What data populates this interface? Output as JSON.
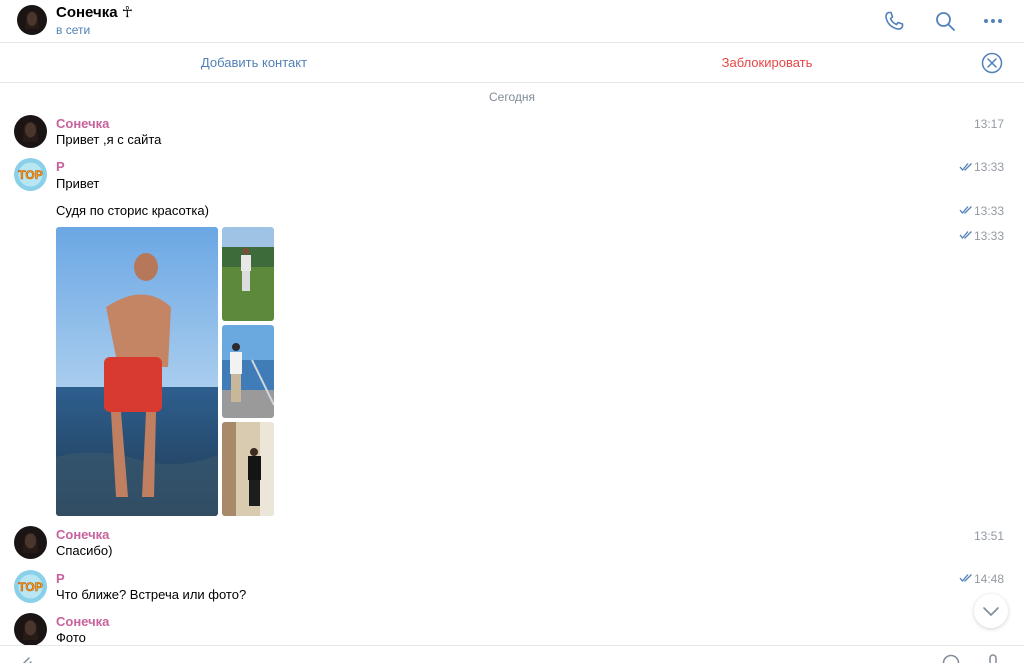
{
  "header": {
    "title": "Сонечка ☥",
    "status": "в сети",
    "icons": [
      "phone-icon",
      "search-icon",
      "more-icon"
    ]
  },
  "actions": {
    "add_contact": "Добавить контакт",
    "block": "Заблокировать"
  },
  "date_separator": "Сегодня",
  "messages": [
    {
      "sender": "Сонечка",
      "text": "Привет ,я с сайта",
      "time": "13:17"
    },
    {
      "sender": "Р",
      "text": "Привет",
      "time": "13:33",
      "read": true
    },
    {
      "text": "Судя по сторис красотка)",
      "time": "13:33",
      "read": true
    },
    {
      "photos": 4,
      "time": "13:33",
      "read": true
    },
    {
      "sender": "Сонечка",
      "text": "Спасибо)",
      "time": "13:51"
    },
    {
      "sender": "Р",
      "text": "Что ближе? Встреча или фото?",
      "time": "14:48",
      "read": true
    },
    {
      "sender": "Сонечка",
      "text": "Фото"
    }
  ],
  "colors": {
    "accent": "#5181b8",
    "danger": "#e64646",
    "sender_name": "#c8629c",
    "meta": "#939aa3"
  }
}
